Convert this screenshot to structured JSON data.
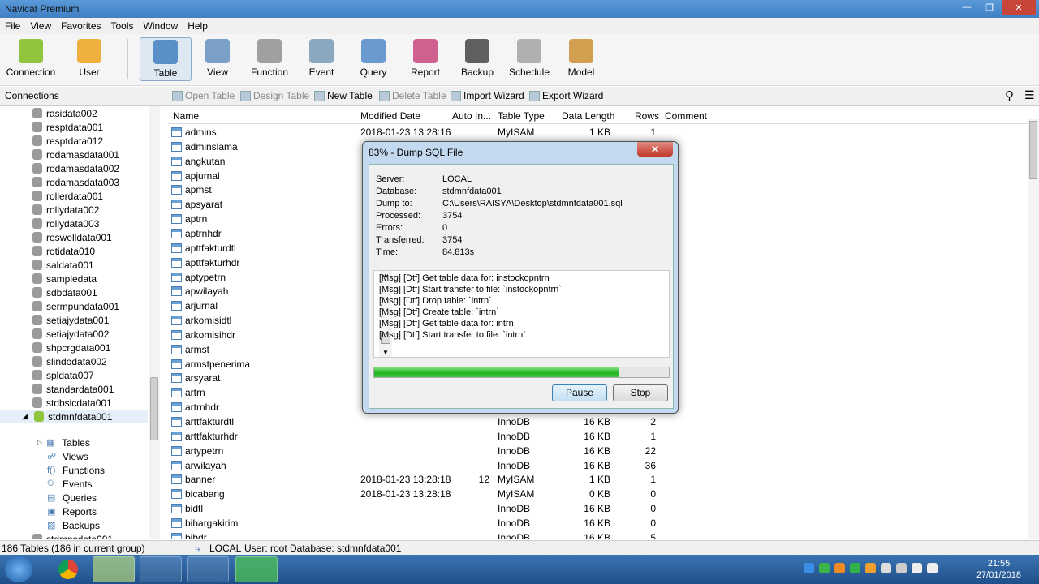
{
  "window": {
    "title": "Navicat Premium"
  },
  "menu": [
    "File",
    "View",
    "Favorites",
    "Tools",
    "Window",
    "Help"
  ],
  "toolbar": [
    {
      "label": "Connection",
      "color": "#8fc43c"
    },
    {
      "label": "User",
      "color": "#f0b040"
    },
    {
      "label": "Table",
      "color": "#5b8fc8",
      "selected": true
    },
    {
      "label": "View",
      "color": "#7aa0c8"
    },
    {
      "label": "Function",
      "color": "#a0a0a0"
    },
    {
      "label": "Event",
      "color": "#8aa8c0"
    },
    {
      "label": "Query",
      "color": "#6a9ad0"
    },
    {
      "label": "Report",
      "color": "#d06090"
    },
    {
      "label": "Backup",
      "color": "#606060"
    },
    {
      "label": "Schedule",
      "color": "#b0b0b0"
    },
    {
      "label": "Model",
      "color": "#d0a050"
    }
  ],
  "subbar": {
    "connections": "Connections",
    "open": "Open Table",
    "design": "Design Table",
    "new": "New Table",
    "delete": "Delete Table",
    "import": "Import Wizard",
    "export": "Export Wizard"
  },
  "sidebar": {
    "items": [
      "rasidata002",
      "resptdata001",
      "resptdata012",
      "rodamasdata001",
      "rodamasdata002",
      "rodamasdata003",
      "rollerdata001",
      "rollydata002",
      "rollydata003",
      "roswelldata001",
      "rotidata010",
      "saldata001",
      "sampledata",
      "sdbdata001",
      "sermpundata001",
      "setiajydata001",
      "setiajydata002",
      "shpcrgdata001",
      "slindodata002",
      "spldata007",
      "standardata001",
      "stdbsicdata001",
      "stdmnfdata001"
    ],
    "selected": "stdmnfdata001",
    "children": [
      "Tables",
      "Views",
      "Functions",
      "Events",
      "Queries",
      "Reports",
      "Backups"
    ],
    "partial": "stdmnsdata001"
  },
  "table": {
    "columns": [
      "Name",
      "Modified Date",
      "Auto In...",
      "Table Type",
      "Data Length",
      "Rows",
      "Comment"
    ],
    "rows": [
      [
        "admins",
        "2018-01-23 13:28:16",
        "",
        "MyISAM",
        "1 KB",
        "1"
      ],
      [
        "adminslama",
        "",
        "",
        "",
        "",
        ""
      ],
      [
        "angkutan",
        "",
        "",
        "",
        "",
        ""
      ],
      [
        "apjurnal",
        "",
        "",
        "",
        "",
        ""
      ],
      [
        "apmst",
        "",
        "",
        "",
        "",
        ""
      ],
      [
        "apsyarat",
        "",
        "",
        "",
        "",
        ""
      ],
      [
        "aptrn",
        "",
        "",
        "",
        "",
        ""
      ],
      [
        "aptrnhdr",
        "",
        "",
        "",
        "",
        ""
      ],
      [
        "apttfakturdtl",
        "",
        "",
        "",
        "",
        ""
      ],
      [
        "apttfakturhdr",
        "",
        "",
        "",
        "",
        ""
      ],
      [
        "aptypetrn",
        "",
        "",
        "",
        "",
        ""
      ],
      [
        "apwilayah",
        "",
        "",
        "",
        "",
        ""
      ],
      [
        "arjurnal",
        "",
        "",
        "",
        "",
        ""
      ],
      [
        "arkomisidtl",
        "",
        "",
        "",
        "",
        ""
      ],
      [
        "arkomisihdr",
        "",
        "",
        "",
        "",
        ""
      ],
      [
        "armst",
        "",
        "",
        "",
        "",
        ""
      ],
      [
        "armstpenerima",
        "",
        "",
        "",
        "",
        ""
      ],
      [
        "arsyarat",
        "",
        "",
        "",
        "",
        ""
      ],
      [
        "artrn",
        "",
        "",
        "",
        "",
        ""
      ],
      [
        "artrnhdr",
        "",
        "",
        "",
        "",
        ""
      ],
      [
        "arttfakturdtl",
        "",
        "",
        "InnoDB",
        "16 KB",
        "2"
      ],
      [
        "arttfakturhdr",
        "",
        "",
        "InnoDB",
        "16 KB",
        "1"
      ],
      [
        "artypetrn",
        "",
        "",
        "InnoDB",
        "16 KB",
        "22"
      ],
      [
        "arwilayah",
        "",
        "",
        "InnoDB",
        "16 KB",
        "36"
      ],
      [
        "banner",
        "2018-01-23 13:28:18",
        "12",
        "MyISAM",
        "1 KB",
        "1"
      ],
      [
        "bicabang",
        "2018-01-23 13:28:18",
        "",
        "MyISAM",
        "0 KB",
        "0"
      ],
      [
        "bidtl",
        "",
        "",
        "InnoDB",
        "16 KB",
        "0"
      ],
      [
        "bihargakirim",
        "",
        "",
        "InnoDB",
        "16 KB",
        "0"
      ],
      [
        "bihdr",
        "",
        "",
        "InnoDB",
        "16 KB",
        "5"
      ]
    ]
  },
  "status": {
    "count": "186 Tables (186 in current group)",
    "server": "LOCAL",
    "user": "User: root",
    "database": "Database: stdmnfdata001"
  },
  "dialog": {
    "title": "83% - Dump SQL File",
    "progress": 83,
    "fields": [
      [
        "Server:",
        "LOCAL"
      ],
      [
        "Database:",
        "stdmnfdata001"
      ],
      [
        "Dump to:",
        "C:\\Users\\RAISYA\\Desktop\\stdmnfdata001.sql"
      ],
      [
        "Processed:",
        "3754"
      ],
      [
        "Errors:",
        "0"
      ],
      [
        "Transferred:",
        "3754"
      ],
      [
        "Time:",
        "84.813s"
      ]
    ],
    "log": [
      "[Msg] [Dtf] Get table data for: instockopntrn",
      "[Msg] [Dtf] Start transfer to file: `instockopntrn`",
      "[Msg] [Dtf] Drop table: `intrn`",
      "[Msg] [Dtf] Create table: `intrn`",
      "[Msg] [Dtf] Get table data for: intrn",
      "[Msg] [Dtf] Start transfer to file: `intrn`"
    ],
    "pause": "Pause",
    "stop": "Stop"
  },
  "taskbar": {
    "time": "21:55",
    "date": "27/01/2018"
  }
}
